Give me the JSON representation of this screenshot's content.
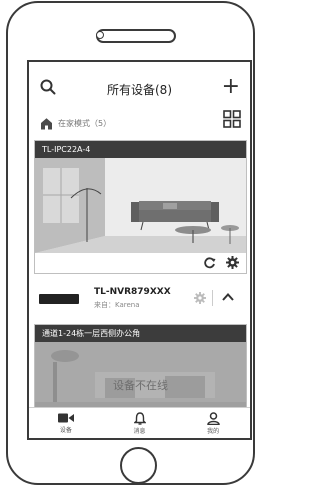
{
  "header": {
    "title": "所有设备(8)"
  },
  "home_mode": {
    "label": "在家模式（5）"
  },
  "camera_card": {
    "name": "TL-IPC22A-4"
  },
  "nvr": {
    "name": "TL-NVR879XXX",
    "source": "来自：Karena"
  },
  "channel_card": {
    "name": "通道1-24栋一层西侧办公角",
    "status": "设备不在线"
  },
  "tabs": [
    {
      "label": "设备",
      "icon": "camera-icon",
      "active": true
    },
    {
      "label": "消息",
      "icon": "bell-icon",
      "active": false
    },
    {
      "label": "我的",
      "icon": "person-icon",
      "active": false
    }
  ],
  "colors": {
    "header_bar": "#3c3c3c",
    "offline_bg": "#a9a9a9",
    "outline": "#3a3a3a"
  }
}
